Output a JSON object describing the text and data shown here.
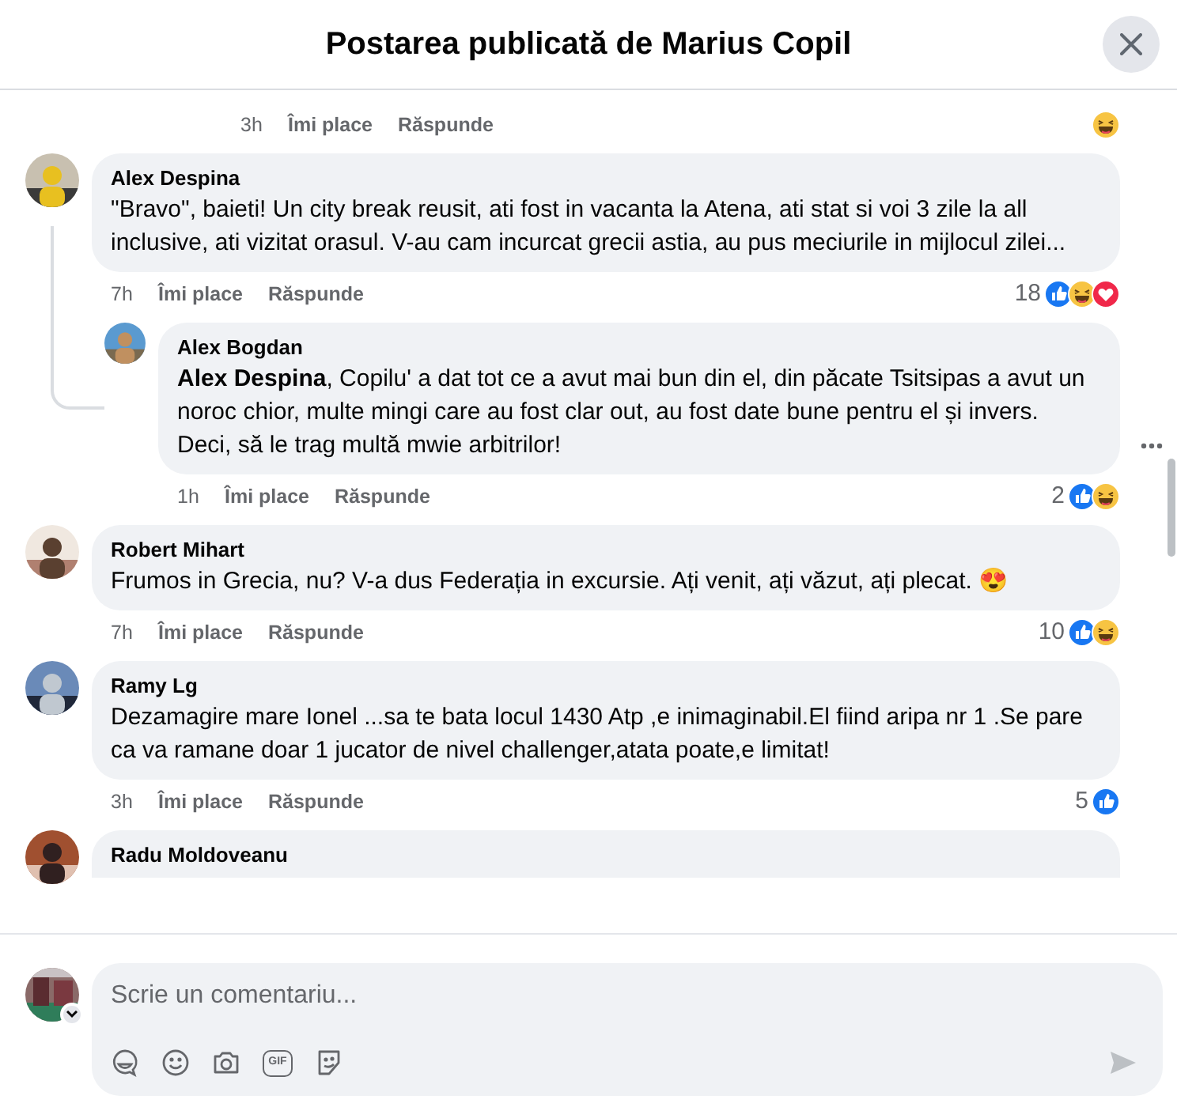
{
  "header": {
    "title": "Postarea publicată de Marius Copil"
  },
  "comments": [
    {
      "kind": "actions-only",
      "time": "3h",
      "like": "Îmi place",
      "reply": "Răspunde",
      "reactions": [
        {
          "kind": "haha"
        }
      ]
    },
    {
      "kind": "comment",
      "author": "Alex Despina",
      "text": "\"Bravo\", baieti! Un city break reusit, ati fost in vacanta la Atena, ati stat si voi 3 zile la all inclusive, ati vizitat orasul. V-au cam incurcat grecii astia, au pus meciurile in mijlocul zilei...",
      "time": "7h",
      "like": "Îmi place",
      "reply": "Răspunde",
      "count": "18",
      "reactions": [
        {
          "kind": "like"
        },
        {
          "kind": "haha"
        },
        {
          "kind": "love"
        }
      ],
      "replies": [
        {
          "kind": "comment",
          "author": "Alex Bogdan",
          "text": "**Alex Despina**, Copilu' a dat tot ce a avut mai bun din el, din păcate Tsitsipas a avut un noroc chior, multe mingi care au fost clar out, au fost date bune pentru el și invers.\nDeci, să le trag multă mwie arbitrilor!",
          "time": "1h",
          "like": "Îmi place",
          "reply": "Răspunde",
          "count": "2",
          "reactions": [
            {
              "kind": "like"
            },
            {
              "kind": "haha"
            }
          ]
        }
      ]
    },
    {
      "kind": "comment",
      "author": "Robert Mihart",
      "text": "Frumos in Grecia, nu? V-a dus Federația in excursie. Ați venit, ați văzut, ați plecat. 😍",
      "time": "7h",
      "like": "Îmi place",
      "reply": "Răspunde",
      "count": "10",
      "reactions": [
        {
          "kind": "like"
        },
        {
          "kind": "haha"
        }
      ]
    },
    {
      "kind": "comment",
      "author": "Ramy Lg",
      "text": "Dezamagire mare Ionel ...sa te bata locul 1430 Atp ,e inimaginabil.El fiind aripa nr 1 .Se pare ca va ramane doar 1 jucator de nivel challenger,atata poate,e limitat!",
      "time": "3h",
      "like": "Îmi place",
      "reply": "Răspunde",
      "count": "5",
      "reactions": [
        {
          "kind": "like"
        }
      ]
    },
    {
      "kind": "cut",
      "author": "Radu Moldoveanu"
    }
  ],
  "composer": {
    "placeholder": "Scrie un comentariu...",
    "gif_label": "GIF"
  }
}
